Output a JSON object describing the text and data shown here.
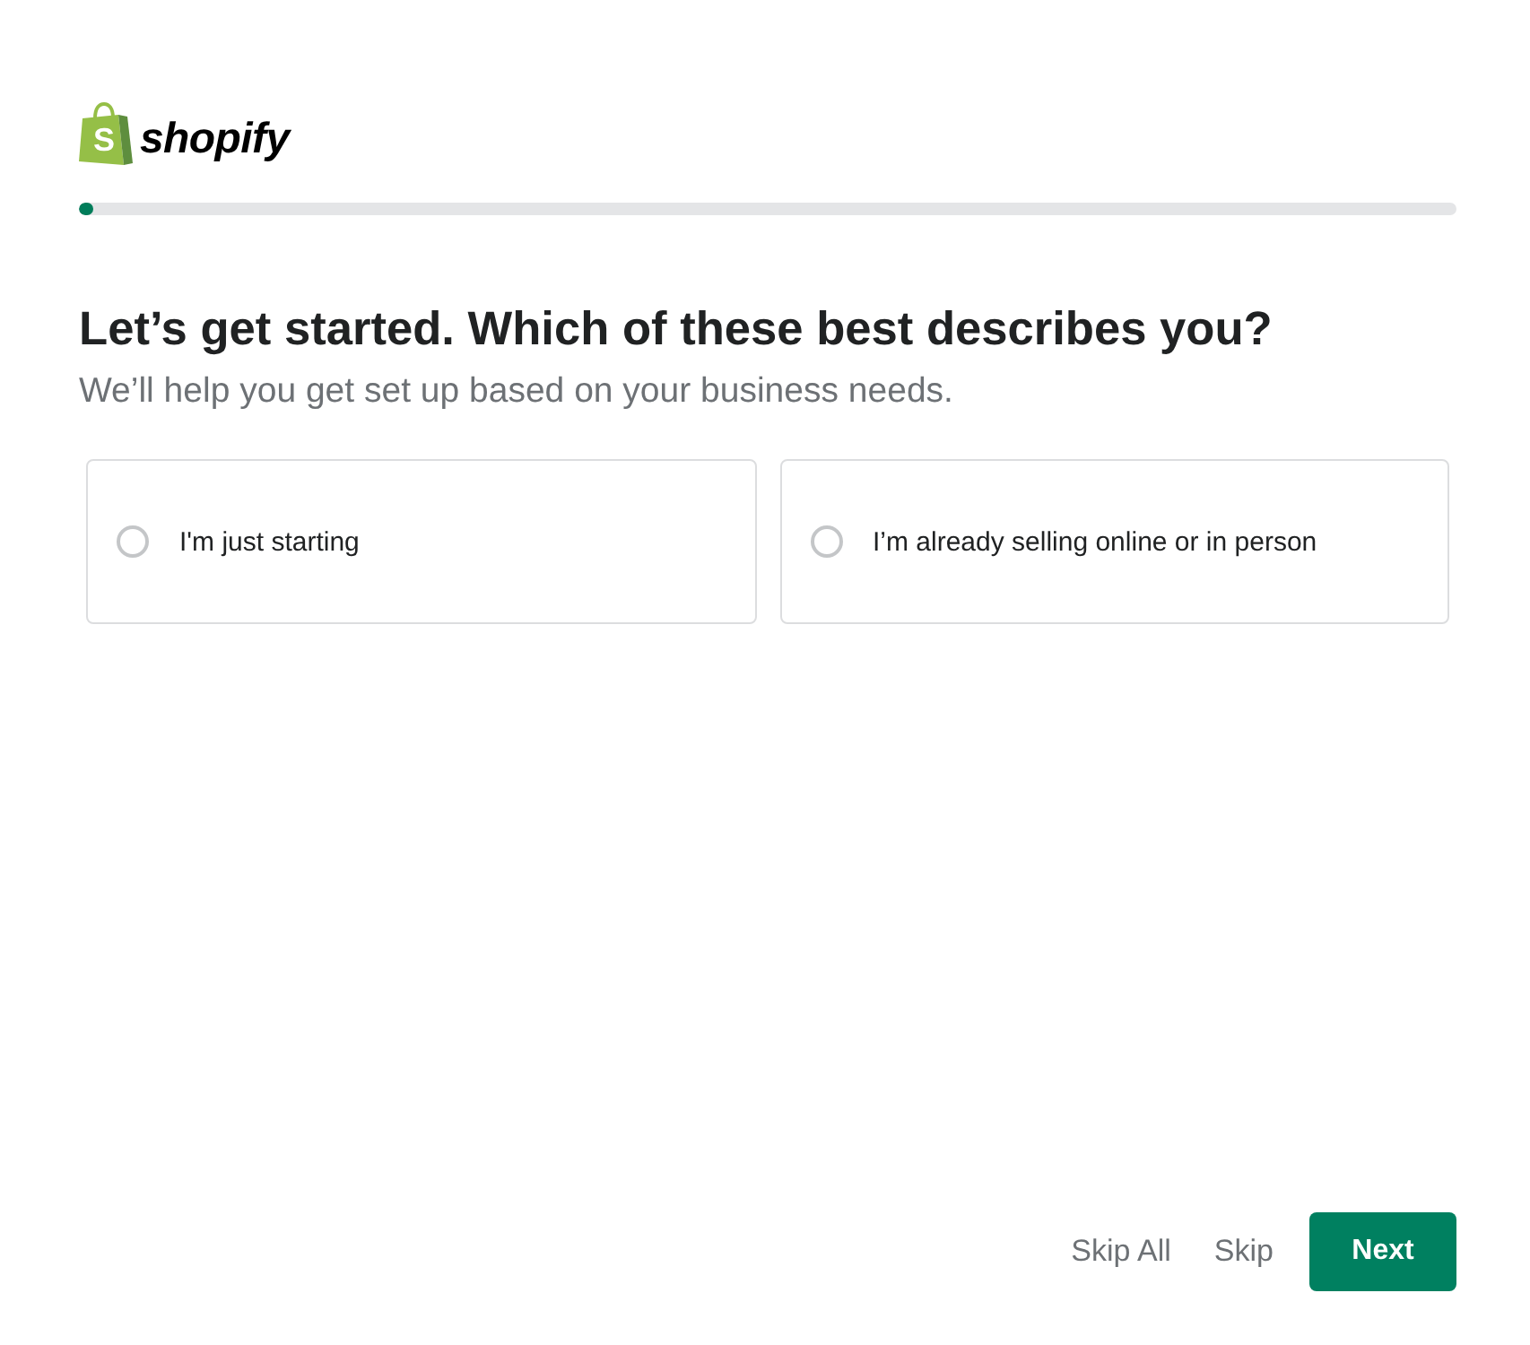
{
  "logo": {
    "mark_letter": "S",
    "text": "shopify"
  },
  "progress": {
    "level": 0.01
  },
  "heading": "Let’s get started. Which of these best describes you?",
  "subheading": "We’ll help you get set up based on your business needs.",
  "options": [
    {
      "label": "I'm just starting",
      "selected": false
    },
    {
      "label": "I’m already selling online or in person",
      "selected": false
    }
  ],
  "actions": [
    {
      "label": "Skip All",
      "kind": "plain"
    },
    {
      "label": "Skip",
      "kind": "plain"
    },
    {
      "label": "Next",
      "kind": "primary"
    }
  ]
}
